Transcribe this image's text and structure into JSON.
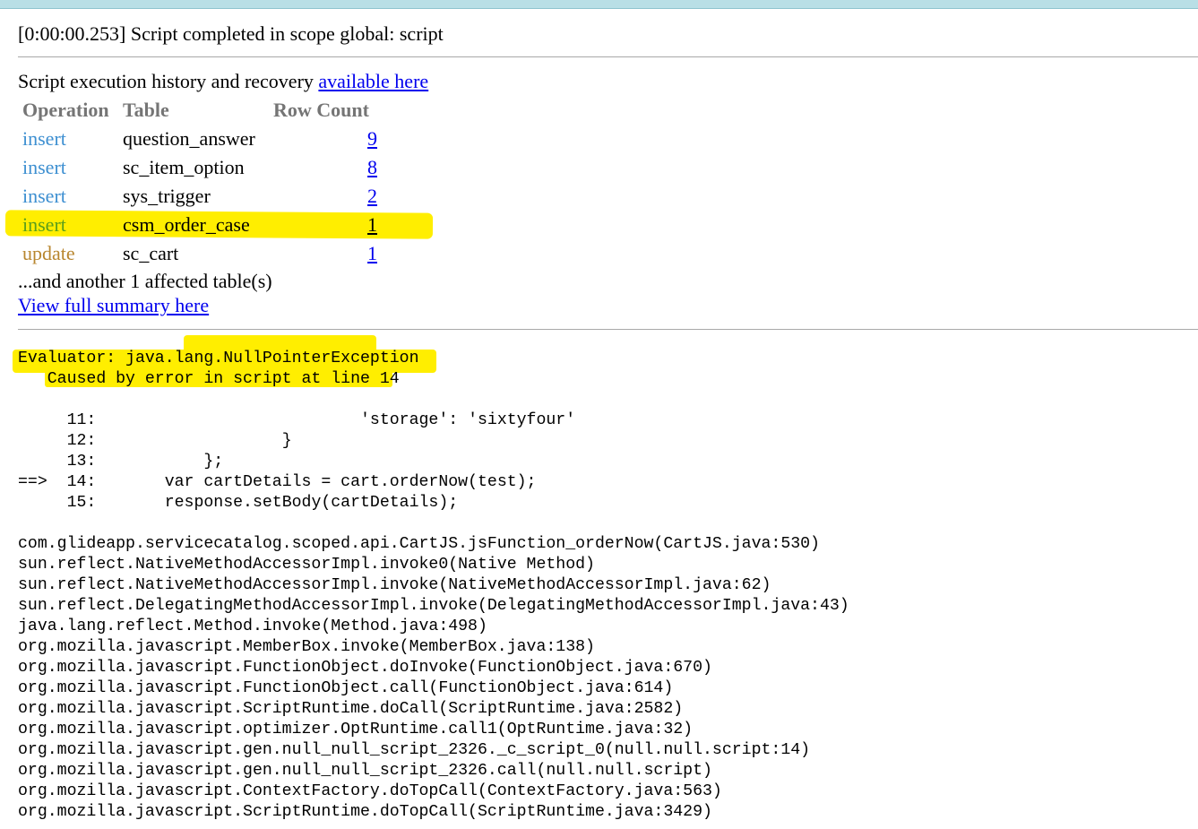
{
  "status": {
    "message": "[0:00:00.253] Script completed in scope global: script"
  },
  "history": {
    "text": "Script execution history and recovery ",
    "link": "available here"
  },
  "operations_table": {
    "headers": [
      "Operation",
      "Table",
      "Row Count"
    ],
    "rows": [
      {
        "operation": "insert",
        "table": "question_answer",
        "count": "9"
      },
      {
        "operation": "insert",
        "table": "sc_item_option",
        "count": "8"
      },
      {
        "operation": "insert",
        "table": "sys_trigger",
        "count": "2"
      },
      {
        "operation": "insert",
        "table": "csm_order_case",
        "count": "1"
      },
      {
        "operation": "update",
        "table": "sc_cart",
        "count": "1"
      }
    ]
  },
  "affected_note": "...and another 1 affected table(s)",
  "full_summary_link": "View full summary here",
  "error": {
    "title": "Evaluator: java.lang.NullPointerException",
    "cause": "   Caused by error in script at line 14"
  },
  "source_lines": [
    {
      "marker": "",
      "num": "11:",
      "code": "                           'storage': 'sixtyfour'"
    },
    {
      "marker": "",
      "num": "12:",
      "code": "                   }"
    },
    {
      "marker": "",
      "num": "13:",
      "code": "           };"
    },
    {
      "marker": "==>",
      "num": "14:",
      "code": "       var cartDetails = cart.orderNow(test);"
    },
    {
      "marker": "",
      "num": "15:",
      "code": "       response.setBody(cartDetails);"
    }
  ],
  "stack_trace": [
    "com.glideapp.servicecatalog.scoped.api.CartJS.jsFunction_orderNow(CartJS.java:530)",
    "sun.reflect.NativeMethodAccessorImpl.invoke0(Native Method)",
    "sun.reflect.NativeMethodAccessorImpl.invoke(NativeMethodAccessorImpl.java:62)",
    "sun.reflect.DelegatingMethodAccessorImpl.invoke(DelegatingMethodAccessorImpl.java:43)",
    "java.lang.reflect.Method.invoke(Method.java:498)",
    "org.mozilla.javascript.MemberBox.invoke(MemberBox.java:138)",
    "org.mozilla.javascript.FunctionObject.doInvoke(FunctionObject.java:670)",
    "org.mozilla.javascript.FunctionObject.call(FunctionObject.java:614)",
    "org.mozilla.javascript.ScriptRuntime.doCall(ScriptRuntime.java:2582)",
    "org.mozilla.javascript.optimizer.OptRuntime.call1(OptRuntime.java:32)",
    "org.mozilla.javascript.gen.null_null_script_2326._c_script_0(null.null.script:14)",
    "org.mozilla.javascript.gen.null_null_script_2326.call(null.null.script)",
    "org.mozilla.javascript.ContextFactory.doTopCall(ContextFactory.java:563)",
    "org.mozilla.javascript.ScriptRuntime.doTopCall(ScriptRuntime.java:3429)"
  ],
  "colors": {
    "highlight": "#ffee00",
    "insert": "#3d8fd1",
    "insert_highlighted": "#5a9e1c",
    "update": "#b8862f",
    "link": "#0000ee",
    "header": "#757575"
  }
}
